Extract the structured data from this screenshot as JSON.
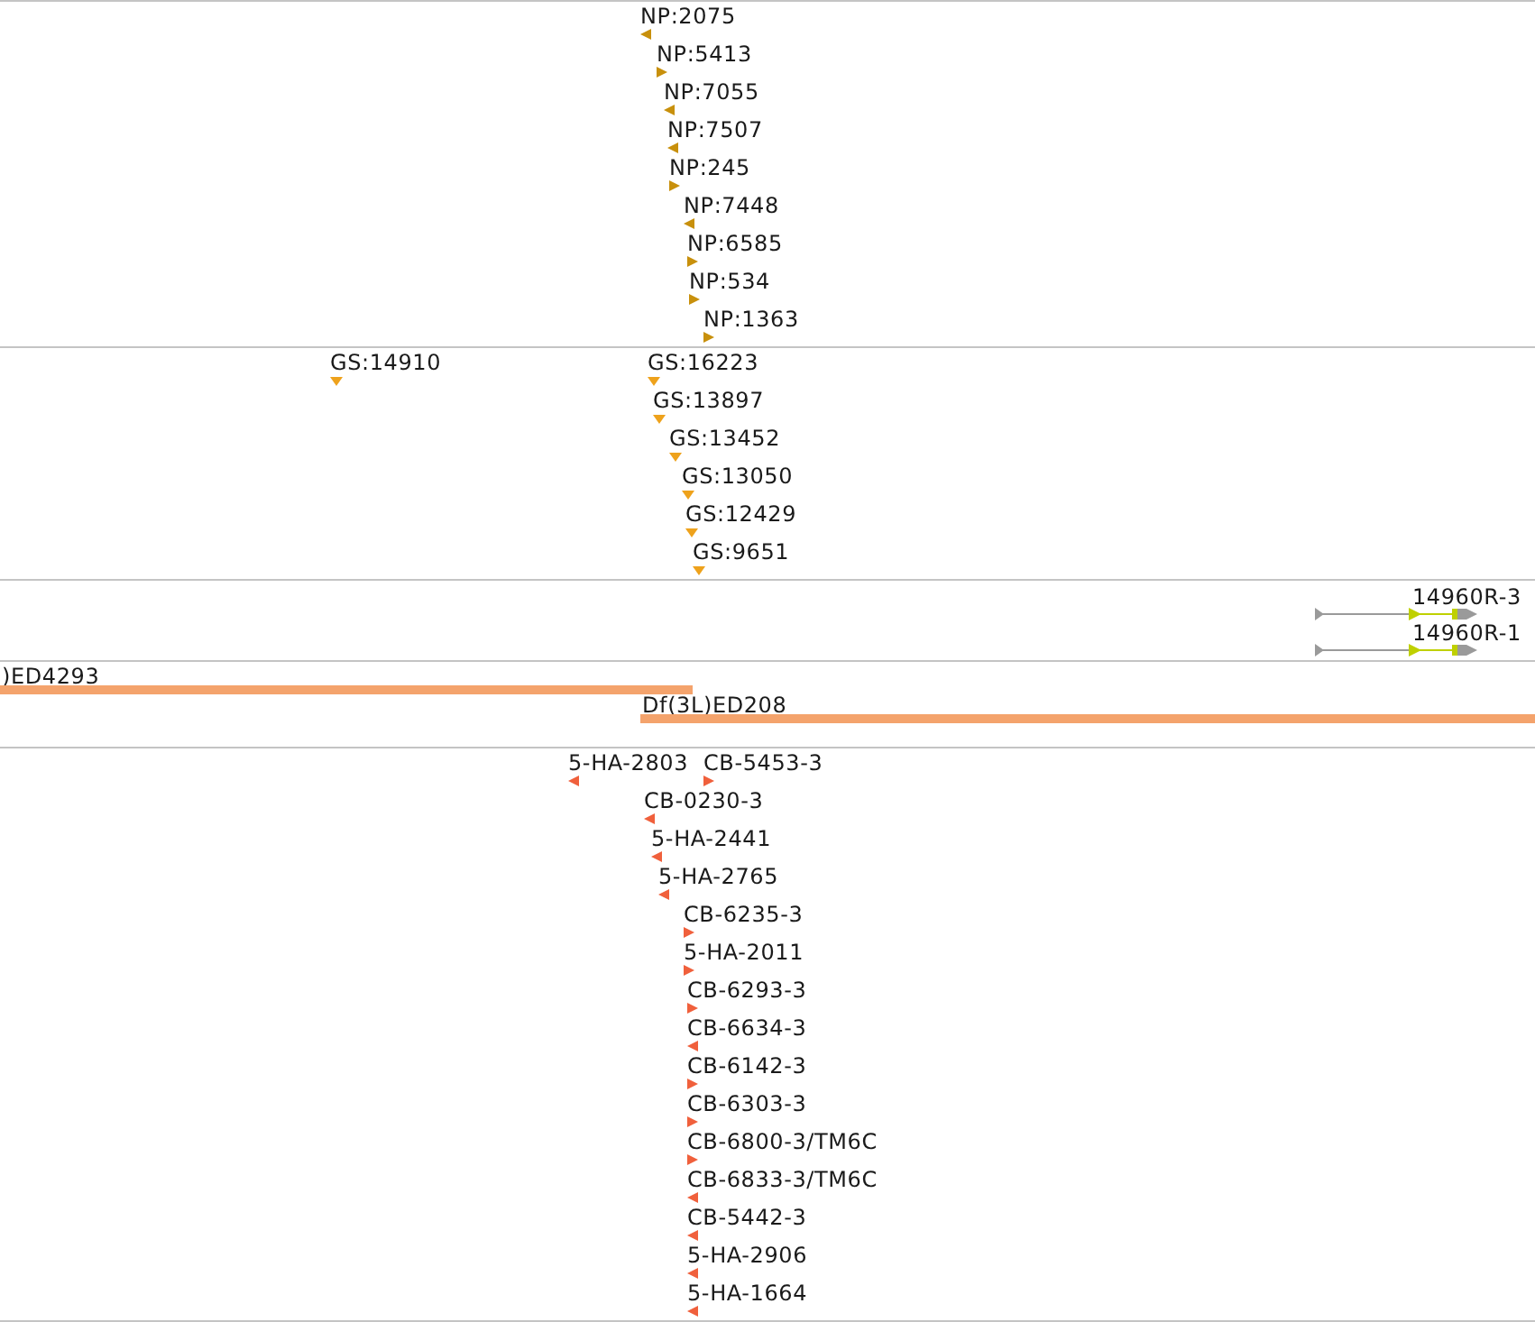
{
  "tracks": [
    {
      "kind": "insertions",
      "color": "#c8900c",
      "features": [
        {
          "label": "NP:2075",
          "reverse": true
        },
        {
          "label": "NP:5413",
          "reverse": false
        },
        {
          "label": "NP:7055",
          "reverse": true
        },
        {
          "label": "NP:7507",
          "reverse": true
        },
        {
          "label": "NP:245",
          "reverse": false
        },
        {
          "label": "NP:7448",
          "reverse": true
        },
        {
          "label": "NP:6585",
          "reverse": false
        },
        {
          "label": "NP:534",
          "reverse": false
        },
        {
          "label": "NP:1363",
          "reverse": false
        }
      ]
    },
    {
      "kind": "sites",
      "color": "#eea21c",
      "features": [
        {
          "label": "GS:14910"
        },
        {
          "label": "GS:16223"
        },
        {
          "label": "GS:13897"
        },
        {
          "label": "GS:13452"
        },
        {
          "label": "GS:13050"
        },
        {
          "label": "GS:12429"
        },
        {
          "label": "GS:9651"
        }
      ]
    },
    {
      "kind": "transcripts",
      "features": [
        {
          "label": "14960R-3"
        },
        {
          "label": "14960R-1"
        }
      ]
    },
    {
      "kind": "deficiencies",
      "color": "#f4a36c",
      "features": [
        {
          "label": ")ED4293"
        },
        {
          "label": "Df(3L)ED208"
        }
      ]
    },
    {
      "kind": "insertions",
      "color": "#f0603c",
      "features": [
        {
          "label": "5-HA-2803",
          "reverse": true
        },
        {
          "label": "CB-5453-3",
          "reverse": false
        },
        {
          "label": "CB-0230-3",
          "reverse": true
        },
        {
          "label": "5-HA-2441",
          "reverse": true
        },
        {
          "label": "5-HA-2765",
          "reverse": true
        },
        {
          "label": "CB-6235-3",
          "reverse": false
        },
        {
          "label": "5-HA-2011",
          "reverse": false
        },
        {
          "label": "CB-6293-3",
          "reverse": false
        },
        {
          "label": "CB-6634-3",
          "reverse": true
        },
        {
          "label": "CB-6142-3",
          "reverse": false
        },
        {
          "label": "CB-6303-3",
          "reverse": false
        },
        {
          "label": "CB-6800-3/TM6C",
          "reverse": false
        },
        {
          "label": "CB-6833-3/TM6C",
          "reverse": true
        },
        {
          "label": "CB-5442-3",
          "reverse": true
        },
        {
          "label": "5-HA-2906",
          "reverse": true
        },
        {
          "label": "5-HA-1664",
          "reverse": true
        }
      ]
    }
  ]
}
